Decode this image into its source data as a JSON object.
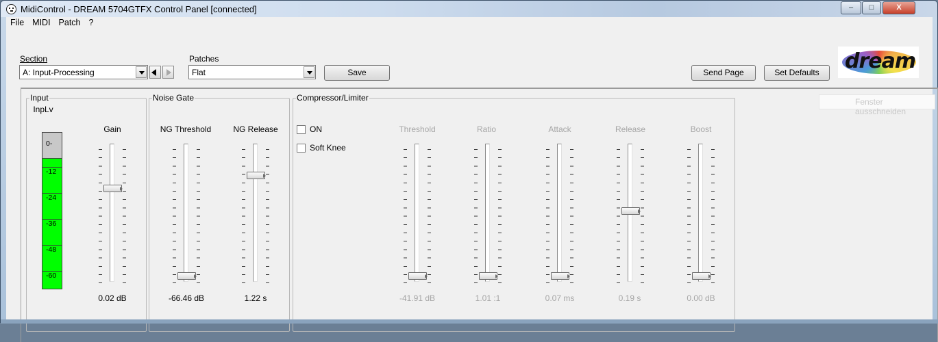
{
  "window": {
    "title": "MidiControl - DREAM 5704GTFX Control Panel [connected]",
    "minimize": "–",
    "maximize": "□",
    "close": "X"
  },
  "menu": [
    "File",
    "MIDI",
    "Patch",
    "?"
  ],
  "section": {
    "label": "Section",
    "value": "A: Input-Processing"
  },
  "patches": {
    "label": "Patches",
    "value": "Flat"
  },
  "buttons": {
    "save": "Save",
    "send_page": "Send Page",
    "set_defaults": "Set Defaults"
  },
  "logo": "dream",
  "ghost_button": "Fenster ausschneiden",
  "input": {
    "title": "Input",
    "meter": {
      "label": "InpLv",
      "segments": [
        "0-",
        "-12",
        "-24",
        "-36",
        "-48",
        "-60"
      ],
      "level": 0.0
    },
    "gain": {
      "label": "Gain",
      "value": "0.02 dB",
      "position": 0.32
    }
  },
  "noise_gate": {
    "title": "Noise Gate",
    "threshold": {
      "label": "NG Threshold",
      "value": "-66.46 dB",
      "position": 0.98
    },
    "release": {
      "label": "NG Release",
      "value": "1.22 s",
      "position": 0.22
    }
  },
  "compressor": {
    "title": "Compressor/Limiter",
    "on_label": "ON",
    "on_checked": false,
    "soft_knee_label": "Soft Knee",
    "soft_knee_checked": false,
    "threshold": {
      "label": "Threshold",
      "value": "-41.91 dB",
      "position": 0.98
    },
    "ratio": {
      "label": "Ratio",
      "value": "1.01 :1",
      "position": 0.98
    },
    "attack": {
      "label": "Attack",
      "value": "0.07 ms",
      "position": 0.98
    },
    "release": {
      "label": "Release",
      "value": "0.19 s",
      "position": 0.49
    },
    "boost": {
      "label": "Boost",
      "value": "0.00 dB",
      "position": 0.98
    }
  }
}
